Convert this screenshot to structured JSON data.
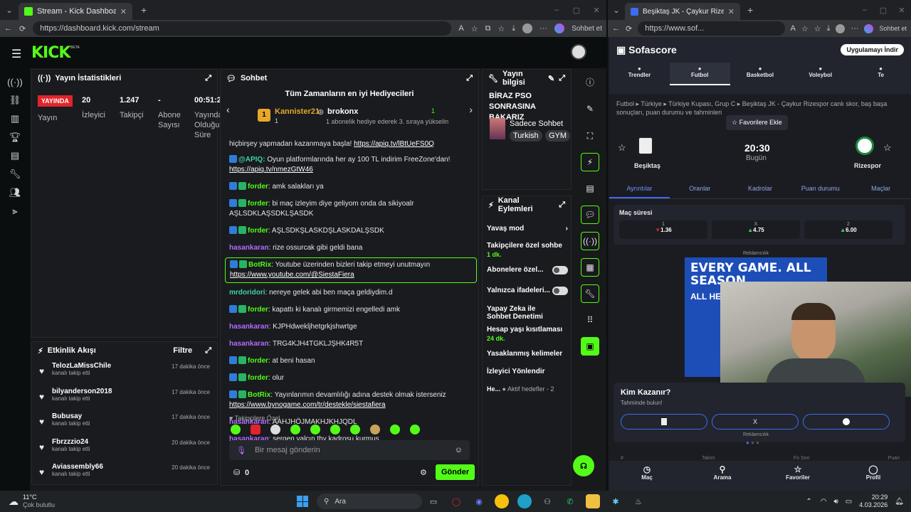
{
  "browser_left": {
    "tab_title": "Stream - Kick Dashboard",
    "url": "https://dashboard.kick.com/stream"
  },
  "browser_right": {
    "tab_title": "Beşiktaş JK - Çaykur Rizespor canlı",
    "url": "https://www.sof...",
    "profile_label": "Sohbet et"
  },
  "profile_label": "Sohbet et",
  "kick": {
    "logo": "KICK",
    "logo_sup": "BETA",
    "stats": {
      "title": "Yayın İstatistikleri",
      "live_badge": "YAYINDA",
      "live_label": "Yayın",
      "viewers_value": "20",
      "viewers_label": "İzleyici",
      "followers_value": "1.247",
      "followers_label": "Takipçi",
      "subs_value": "-",
      "subs_label_1": "Abone",
      "subs_label_2": "Sayısı",
      "duration_value": "00:51:2",
      "duration_label_1": "Yayında",
      "duration_label_2": "Olduğu",
      "duration_label_3": "Süre"
    },
    "activity": {
      "title": "Etkinlik Akışı",
      "filter": "Filtre",
      "items": [
        {
          "name": "TelozLaMissChile",
          "action": "kanalı takip etti",
          "time": "17 dakika önce"
        },
        {
          "name": "bilyanderson2018",
          "action": "kanalı takip etti",
          "time": "17 dakika önce"
        },
        {
          "name": "Bubusay",
          "action": "kanalı takip etti",
          "time": "17 dakika önce"
        },
        {
          "name": "Fbrzzzio24",
          "action": "kanalı takip etti",
          "time": "20 dakika önce"
        },
        {
          "name": "Aviassembly66",
          "action": "kanalı takip etti",
          "time": "20 dakika önce"
        }
      ]
    },
    "chat": {
      "title": "Sohbet",
      "gifters_title": "Tüm Zamanların en iyi Hediyecileri",
      "gifter1_rank": "1",
      "gifter1_name": "Kannister21",
      "gifter1_count": "1",
      "gifter2_name": "brokonx",
      "gifter2_count": "1",
      "gifter_note": "1 abonelik hediye ederek 3. sıraya yükselin",
      "first_line": "hiçbirşey yapmadan kazanmaya başla!",
      "first_link": "https://apiq.tv/lBtUeFS0Q",
      "apiq_user": "@APIQ:",
      "apiq_text": "Oyun platformlarında her ay 100 TL indirim FreeZone'dan!",
      "apiq_link": "https://apiq.tv/nmezGtW46",
      "m1_user": "forder",
      "m1_text": ": amk salakları ya",
      "m2_user": "forder",
      "m2_text": ": bi maç izleyim diye geliyom onda da sikiyoalr AŞLSDKLAŞSDKLŞASDK",
      "m3_user": "forder",
      "m3_text": ": AŞLSDKŞLASKDŞLASKDALŞSDK",
      "m4_user": "hasankaran",
      "m4_text": ": rize ossurcak gibi geldi bana",
      "m5_user": "BotRix",
      "m5_text": ": Youtube üzerinden bizleri takip etmeyi unutmayın",
      "m5_link": "https://www.youtube.com/@SiestaFiera",
      "m6_user": "mrdoridori",
      "m6_text": ": nereye gelek abi ben maça geldiydim.d",
      "m7_user": "forder",
      "m7_text": ": kapattı ki kanalı girmemizi engelledi amk",
      "m8_user": "hasankaran",
      "m8_text": ": KJPHdwekljhetgrkjshwrtge",
      "m9_user": "hasankaran",
      "m9_text": ": TRG4KJH4TGKLJŞHK4R5T",
      "m10_user": "forder",
      "m10_text": ": at beni hasan",
      "m11_user": "forder",
      "m11_text": ": olur",
      "m12_user": "BotRix",
      "m12_text": ": Yayınlarımın devamlılığı adına destek olmak isterseniz",
      "m12_link": "https://www.bynogame.com/tr/destekle/siestafiera",
      "m13_user": "hasankaran",
      "m13_text": ": AAHJHÖJMAKHJKHJQDL",
      "m14_user": "hasankaran",
      "m14_text": ": sergen yalcın thy kadrosu kurmus",
      "followers_only": "Takipçilere Özel",
      "input_placeholder": "Bir mesaj gönderin",
      "points": "0",
      "send": "Gönder"
    },
    "info": {
      "title": "Yayın bilgisi",
      "stream_title": "BİRAZ PSO SONRASINA BAKARIZ",
      "category": "Sadece Sohbet",
      "tag1": "Turkish",
      "tag2": "GYM"
    },
    "actions": {
      "title": "Kanal Eylemleri",
      "slow": "Yavaş mod",
      "followers_chat": "Takipçilere özel sohbe",
      "followers_sub": "1 dk.",
      "subs": "Abonelere özel...",
      "emotes": "Yalnızca ifadeleri...",
      "ai_1": "Yapay Zeka ile",
      "ai_2": "Sohbet Denetimi",
      "age": "Hesap yaşı kısıtlaması",
      "age_sub": "24 dk.",
      "banned": "Yasaklanmış kelimeler",
      "viewer_goals": "İzleyici Yönlendir",
      "he": "He...",
      "active_goals": "Aktif hedefler - 2"
    }
  },
  "sofa": {
    "logo": "Sofascore",
    "app_btn": "Uygulamayı İndir",
    "nav": [
      "Trendler",
      "Futbol",
      "Basketbol",
      "Voleybol",
      "Te"
    ],
    "breadcrumb": "Futbol ▸ Türkiye ▸ Türkiye Kupası, Grup C ▸ Beşiktaş JK - Çaykur Rizespor canlı skor, baş başa sonuçları, puan durumu ve tahminleri",
    "fav_btn": "Favorilere Ekle",
    "home": "Beşiktaş",
    "away": "Rizespor",
    "time": "20:30",
    "day": "Bugün",
    "tabs": [
      "Ayrıntılar",
      "Oranlar",
      "Kadrolar",
      "Puan durumu",
      "Maçlar"
    ],
    "odds_title": "Maç süresi",
    "odds": [
      {
        "label": "1",
        "value": "1.36",
        "dir": "down"
      },
      {
        "label": "X",
        "value": "4.75",
        "dir": "up"
      },
      {
        "label": "2",
        "value": "6.00",
        "dir": "up"
      }
    ],
    "ad_label": "Reklamcılık",
    "ad_text": "EVERY GAME. ALL SEASON.",
    "ad_sub": "ALL HERE",
    "who_title": "Kim Kazanır?",
    "who_sub": "Tahminde bulun!",
    "vote_x": "X",
    "bottom_nav": [
      "Maç",
      "Arama",
      "Favoriler",
      "Profil"
    ],
    "peek_1": "#",
    "peek_2": "Takım",
    "peek_3": "Fo Son",
    "peek_4": "Puan"
  },
  "taskbar": {
    "temp": "11°C",
    "weather": "Çok bulutlu",
    "search": "Ara",
    "time": "20:29",
    "date": "4.03.2026"
  },
  "colors": {
    "kick_green": "#53fc18",
    "live_red": "#e0242c",
    "sofa_blue": "#3d6cf2"
  }
}
